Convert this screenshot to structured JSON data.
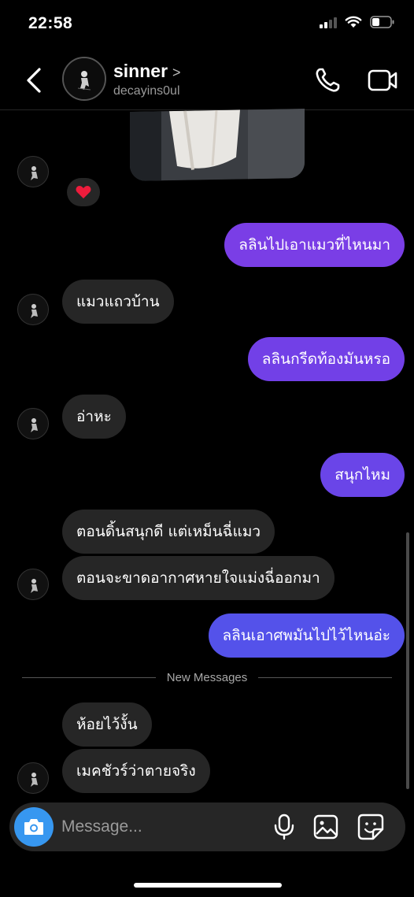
{
  "status": {
    "time": "22:58"
  },
  "header": {
    "name": "sinner",
    "chevron": ">",
    "handle": "decayins0ul"
  },
  "reaction": {
    "emoji": "❤️"
  },
  "messages": [
    {
      "side": "out",
      "text": "ลลินไปเอาแมวที่ไหนมา"
    },
    {
      "side": "in",
      "text": "แมวแถวบ้าน"
    },
    {
      "side": "out",
      "text": "ลลินกรีดท้องมันหรอ"
    },
    {
      "side": "in",
      "text": "อ่าหะ"
    },
    {
      "side": "out",
      "text": "สนุกไหม"
    },
    {
      "side": "in",
      "text": "ตอนดิ้นสนุกดี แต่เหม็นฉี่แมว"
    },
    {
      "side": "in",
      "text": "ตอนจะขาดอากาศหายใจแม่งฉี่ออกมา"
    },
    {
      "side": "out",
      "text": "ลลินเอาศพมันไปไว้ไหนอ่ะ"
    },
    {
      "side": "in",
      "text": "ห้อยไว้งั้น"
    },
    {
      "side": "in",
      "text": "เมคชัวร์ว่าตายจริง"
    }
  ],
  "divider": {
    "label": "New Messages"
  },
  "composer": {
    "placeholder": "Message..."
  },
  "colors": {
    "out_purple": "#7a3ee6",
    "out_violet": "#6a45e8",
    "out_blue": "#5452ea",
    "in_bubble": "#262626",
    "camera": "#3797f0"
  }
}
